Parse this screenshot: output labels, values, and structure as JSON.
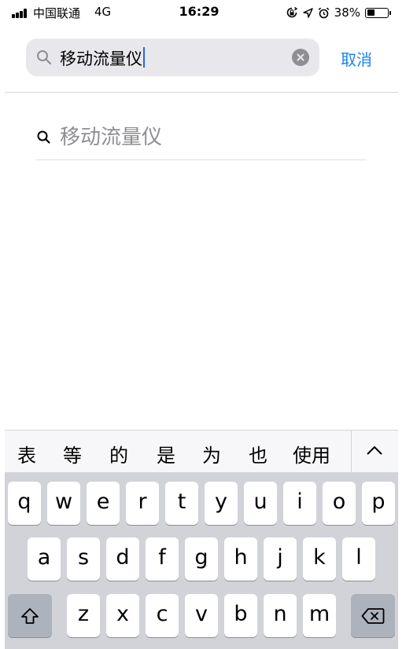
{
  "status_bar": {
    "carrier": "中国联通",
    "network": "4G",
    "time": "16:29",
    "battery": "38%",
    "battery_level": 0.38
  },
  "search": {
    "query": "移动流量仪",
    "cancel_label": "取消"
  },
  "suggestions": [
    {
      "text": "移动流量仪"
    }
  ],
  "candidates": [
    "表",
    "等",
    "的",
    "是",
    "为",
    "也",
    "使用"
  ],
  "keyboard": {
    "row1": [
      "q",
      "w",
      "e",
      "r",
      "t",
      "y",
      "u",
      "i",
      "o",
      "p"
    ],
    "row2": [
      "a",
      "s",
      "d",
      "f",
      "g",
      "h",
      "j",
      "k",
      "l"
    ],
    "row3": [
      "z",
      "x",
      "c",
      "v",
      "b",
      "n",
      "m"
    ]
  }
}
